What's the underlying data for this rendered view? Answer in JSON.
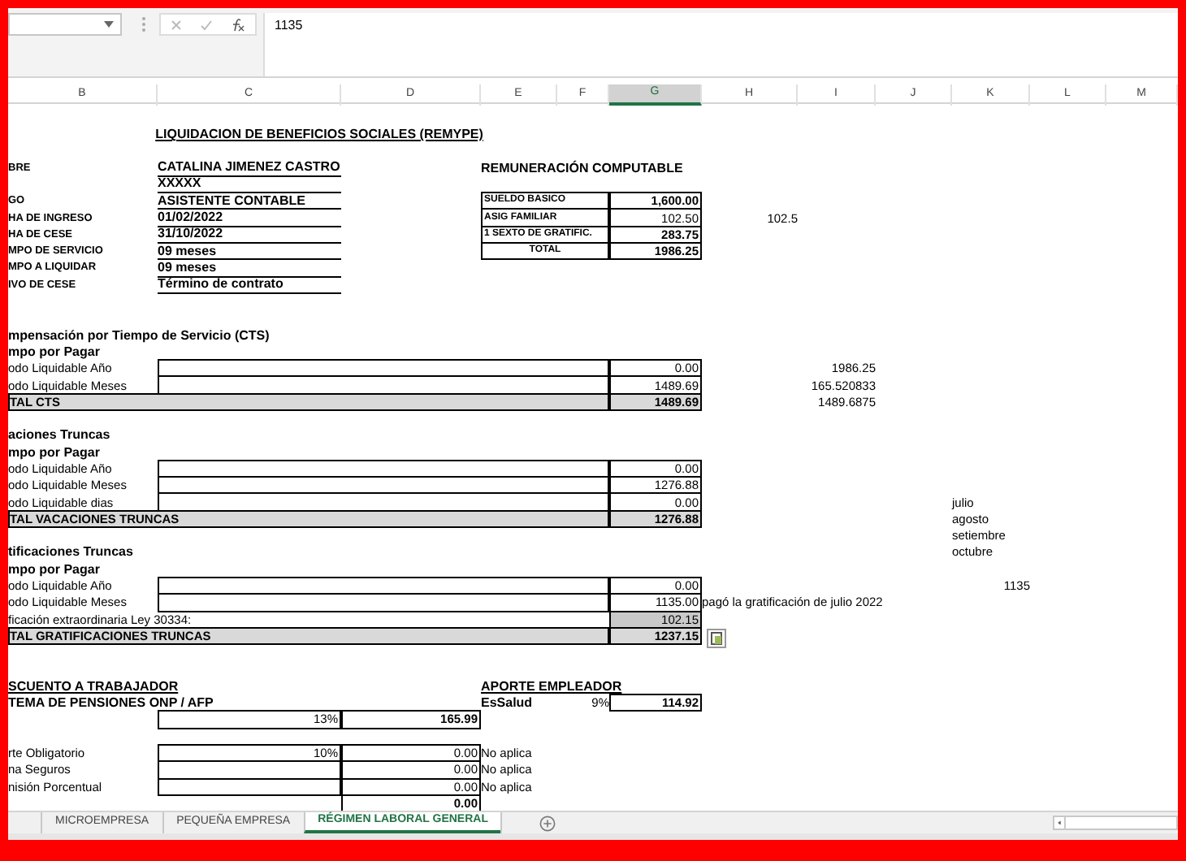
{
  "formula_bar": {
    "value": "1135"
  },
  "columns": [
    {
      "label": "B",
      "selected": false
    },
    {
      "label": "C",
      "selected": false
    },
    {
      "label": "D",
      "selected": false
    },
    {
      "label": "E",
      "selected": false
    },
    {
      "label": "F",
      "selected": false
    },
    {
      "label": "G",
      "selected": true
    },
    {
      "label": "H",
      "selected": false
    },
    {
      "label": "I",
      "selected": false
    },
    {
      "label": "J",
      "selected": false
    },
    {
      "label": "K",
      "selected": false
    },
    {
      "label": "L",
      "selected": false
    },
    {
      "label": "M",
      "selected": false
    }
  ],
  "rows": [
    {
      "kind": "data",
      "cells": {
        "C": {
          "kind": "title",
          "text": "LIQUIDACION DE BENEFICIOS SOCIALES (REMYPE)"
        }
      }
    },
    {
      "kind": "blank"
    },
    {
      "kind": "data",
      "cells": {
        "B": {
          "kind": "label",
          "text": "BRE"
        },
        "C": {
          "kind": "field",
          "text": "CATALINA JIMENEZ CASTRO"
        },
        "E": {
          "kind": "heading",
          "text": "REMUNERACIÓN COMPUTABLE"
        }
      }
    },
    {
      "kind": "data",
      "cells": {
        "C": {
          "kind": "field",
          "text": "XXXXX"
        }
      }
    },
    {
      "kind": "data",
      "cells": {
        "B": {
          "kind": "label",
          "text": "GO"
        },
        "C": {
          "kind": "field",
          "text": "ASISTENTE CONTABLE"
        },
        "E": {
          "kind": "rem_label",
          "text": "SUELDO BASICO"
        },
        "G": {
          "kind": "box_bold",
          "text": "1,600.00"
        }
      }
    },
    {
      "kind": "data",
      "cells": {
        "B": {
          "kind": "label",
          "text": "HA DE INGRESO"
        },
        "C": {
          "kind": "field",
          "text": "01/02/2022"
        },
        "E": {
          "kind": "rem_label",
          "text": "ASIG FAMILIAR"
        },
        "G": {
          "kind": "box_num",
          "text": "102.50"
        },
        "H": {
          "kind": "num",
          "text": "102.5"
        }
      }
    },
    {
      "kind": "data",
      "cells": {
        "B": {
          "kind": "label",
          "text": "HA DE CESE"
        },
        "C": {
          "kind": "field",
          "text": "31/10/2022"
        },
        "E": {
          "kind": "rem_label",
          "text": "1 SEXTO DE GRATIFIC."
        },
        "G": {
          "kind": "box_bold",
          "text": "283.75"
        }
      }
    },
    {
      "kind": "data",
      "cells": {
        "B": {
          "kind": "label",
          "text": "MPO DE SERVICIO"
        },
        "C": {
          "kind": "field",
          "text": "09 meses"
        },
        "E": {
          "kind": "rem_total",
          "text": "TOTAL"
        },
        "G": {
          "kind": "box_bold",
          "text": "1986.25"
        }
      }
    },
    {
      "kind": "data",
      "cells": {
        "B": {
          "kind": "label",
          "text": "MPO A LIQUIDAR"
        },
        "C": {
          "kind": "field",
          "text": "09 meses"
        }
      }
    },
    {
      "kind": "data",
      "cells": {
        "B": {
          "kind": "label",
          "text": "IVO DE CESE"
        },
        "C": {
          "kind": "field",
          "text": "Término de contrato"
        }
      }
    },
    {
      "kind": "blank"
    },
    {
      "kind": "blank"
    },
    {
      "kind": "data",
      "cells": {
        "B": {
          "kind": "heading",
          "text": "mpensación por Tiempo de Servicio (CTS)"
        }
      }
    },
    {
      "kind": "data",
      "cells": {
        "B": {
          "kind": "heading",
          "text": "mpo por Pagar"
        }
      }
    },
    {
      "kind": "data",
      "cells": {
        "B": {
          "kind": "text",
          "text": "odo Liquidable Año"
        },
        "C": {
          "kind": "box"
        },
        "G": {
          "kind": "box_num",
          "text": "0.00"
        },
        "I": {
          "kind": "num",
          "text": "1986.25"
        }
      }
    },
    {
      "kind": "data",
      "cells": {
        "B": {
          "kind": "text",
          "text": "odo Liquidable Meses"
        },
        "C": {
          "kind": "box"
        },
        "G": {
          "kind": "box_num",
          "text": "1489.69"
        },
        "I": {
          "kind": "num",
          "text": "165.520833"
        }
      }
    },
    {
      "kind": "data",
      "cells": {
        "B": {
          "kind": "total_label",
          "text": "TAL  CTS"
        },
        "G": {
          "kind": "total_value",
          "text": "1489.69"
        },
        "I": {
          "kind": "num",
          "text": "1489.6875"
        }
      }
    },
    {
      "kind": "blank"
    },
    {
      "kind": "data",
      "cells": {
        "B": {
          "kind": "heading",
          "text": "aciones Truncas"
        }
      }
    },
    {
      "kind": "data",
      "cells": {
        "B": {
          "kind": "heading",
          "text": "mpo por Pagar"
        }
      }
    },
    {
      "kind": "data",
      "cells": {
        "B": {
          "kind": "text",
          "text": "odo Liquidable Año"
        },
        "C": {
          "kind": "box"
        },
        "G": {
          "kind": "box_num",
          "text": "0.00"
        }
      }
    },
    {
      "kind": "data",
      "cells": {
        "B": {
          "kind": "text",
          "text": "odo Liquidable Meses"
        },
        "C": {
          "kind": "box"
        },
        "G": {
          "kind": "box_num",
          "text": "1276.88"
        }
      }
    },
    {
      "kind": "data",
      "cells": {
        "B": {
          "kind": "text",
          "text": "odo Liquidable dias"
        },
        "C": {
          "kind": "box"
        },
        "G": {
          "kind": "box_num",
          "text": "0.00"
        },
        "K": {
          "kind": "text",
          "text": "julio"
        }
      }
    },
    {
      "kind": "data",
      "cells": {
        "B": {
          "kind": "total_label",
          "text": "TAL VACACIONES TRUNCAS"
        },
        "G": {
          "kind": "total_value",
          "text": "1276.88"
        },
        "K": {
          "kind": "text",
          "text": "agosto"
        }
      }
    },
    {
      "kind": "data",
      "cells": {
        "K": {
          "kind": "text",
          "text": "setiembre"
        }
      }
    },
    {
      "kind": "data",
      "cells": {
        "B": {
          "kind": "heading",
          "text": "tificaciones Truncas"
        },
        "K": {
          "kind": "text",
          "text": "octubre"
        }
      }
    },
    {
      "kind": "data",
      "cells": {
        "B": {
          "kind": "heading",
          "text": "mpo por Pagar"
        }
      }
    },
    {
      "kind": "data",
      "cells": {
        "B": {
          "kind": "text",
          "text": "odo Liquidable Año"
        },
        "C": {
          "kind": "box"
        },
        "G": {
          "kind": "box_num",
          "text": "0.00"
        },
        "K": {
          "kind": "num",
          "text": "1135"
        }
      }
    },
    {
      "kind": "data",
      "cells": {
        "B": {
          "kind": "text",
          "text": "odo Liquidable Meses"
        },
        "C": {
          "kind": "box"
        },
        "G": {
          "kind": "box_num",
          "text": "1135.00"
        },
        "H": {
          "kind": "text",
          "text": "pagó la gratificación de julio 2022"
        }
      }
    },
    {
      "kind": "data",
      "cells": {
        "B": {
          "kind": "text",
          "text": "ficación extraordinaria Ley 30334:"
        },
        "G": {
          "kind": "box_shaded",
          "text": "102.15"
        }
      }
    },
    {
      "kind": "data",
      "cells": {
        "B": {
          "kind": "total_label",
          "text": "TAL GRATIFICACIONES TRUNCAS"
        },
        "G": {
          "kind": "total_value",
          "text": "1237.15"
        },
        "H": {
          "kind": "paste_icon"
        }
      }
    },
    {
      "kind": "blank"
    },
    {
      "kind": "blank"
    },
    {
      "kind": "data",
      "cells": {
        "B": {
          "kind": "heading_u",
          "text": "SCUENTO A TRABAJADOR"
        },
        "E": {
          "kind": "heading_u",
          "text": "APORTE EMPLEADOR"
        }
      }
    },
    {
      "kind": "data",
      "cells": {
        "B": {
          "kind": "heading",
          "text": "TEMA DE PENSIONES ONP / AFP"
        },
        "E": {
          "kind": "heading",
          "text": "EsSalud"
        },
        "F": {
          "kind": "num",
          "text": "9%"
        },
        "G": {
          "kind": "box_bold",
          "text": "114.92"
        }
      }
    },
    {
      "kind": "data",
      "cells": {
        "C": {
          "kind": "box_num",
          "text": "13%"
        },
        "D": {
          "kind": "box_bold",
          "text": "165.99"
        }
      }
    },
    {
      "kind": "blank"
    },
    {
      "kind": "data",
      "cells": {
        "B": {
          "kind": "text",
          "text": "rte Obligatorio"
        },
        "C": {
          "kind": "box_num",
          "text": "10%"
        },
        "D": {
          "kind": "box_num",
          "text": "0.00"
        },
        "E": {
          "kind": "text",
          "text": "No aplica"
        }
      }
    },
    {
      "kind": "data",
      "cells": {
        "B": {
          "kind": "text",
          "text": "na Seguros"
        },
        "C": {
          "kind": "box"
        },
        "D": {
          "kind": "box_num",
          "text": "0.00"
        },
        "E": {
          "kind": "text",
          "text": "No aplica"
        }
      }
    },
    {
      "kind": "data",
      "cells": {
        "B": {
          "kind": "text",
          "text": "nisión Porcentual"
        },
        "C": {
          "kind": "box"
        },
        "D": {
          "kind": "box_num",
          "text": "0.00"
        },
        "E": {
          "kind": "text",
          "text": "No aplica"
        }
      }
    },
    {
      "kind": "data",
      "cells": {
        "D": {
          "kind": "box_bold",
          "text": "0.00"
        }
      }
    }
  ],
  "sheet_tabs": [
    {
      "label": "MICROEMPRESA",
      "selected": false
    },
    {
      "label": "PEQUEÑA EMPRESA",
      "selected": false
    },
    {
      "label": "RÉGIMEN LABORAL GENERAL",
      "selected": true
    }
  ]
}
